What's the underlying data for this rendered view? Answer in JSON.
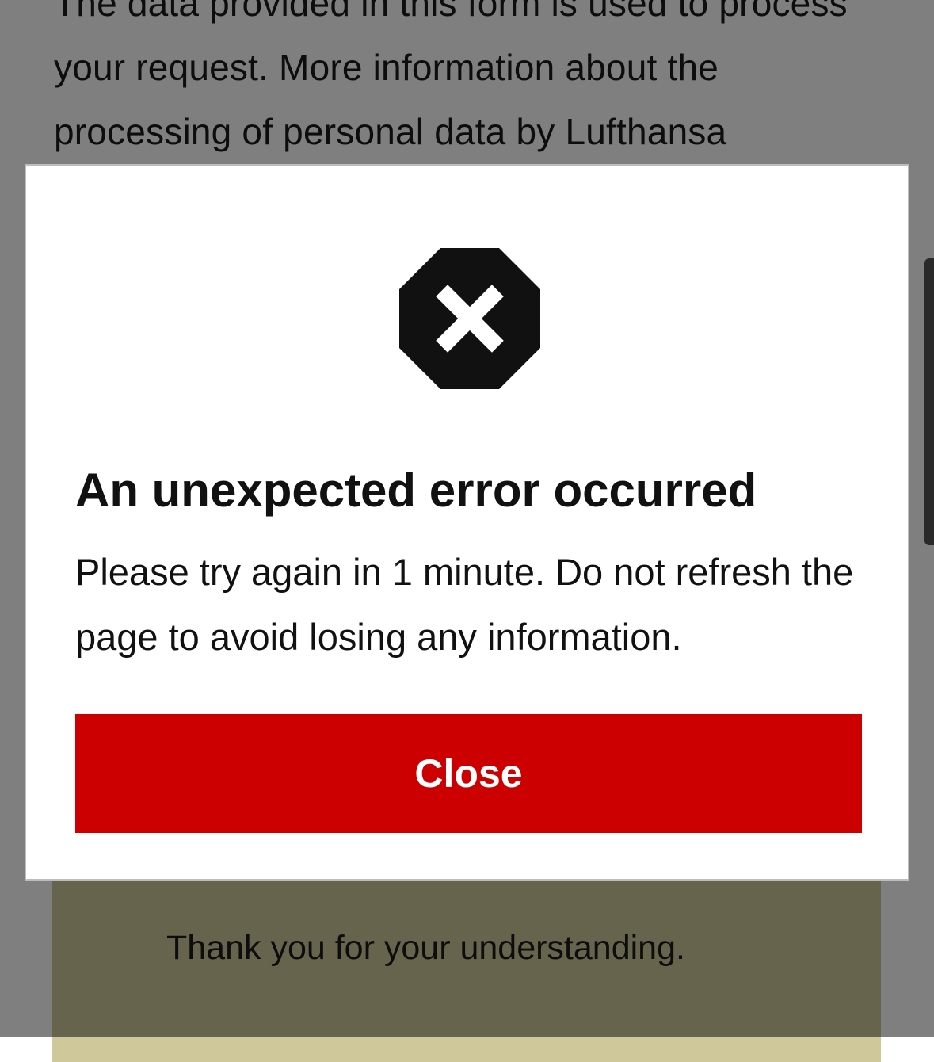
{
  "background_page": {
    "privacy_text": "The data provided in this form is used to process your request. More information about the processing of personal data by Lufthansa",
    "banner_text": "Thank you for your understanding."
  },
  "error_dialog": {
    "icon": "error-octagon-x-icon",
    "title": "An unexpected error occurred",
    "message": "Please try again in 1 minute. Do not refresh the page to avoid losing any information.",
    "close_label": "Close"
  },
  "colors": {
    "primary_button": "#cc0000",
    "icon": "#111111",
    "banner": "#cfc89a"
  }
}
